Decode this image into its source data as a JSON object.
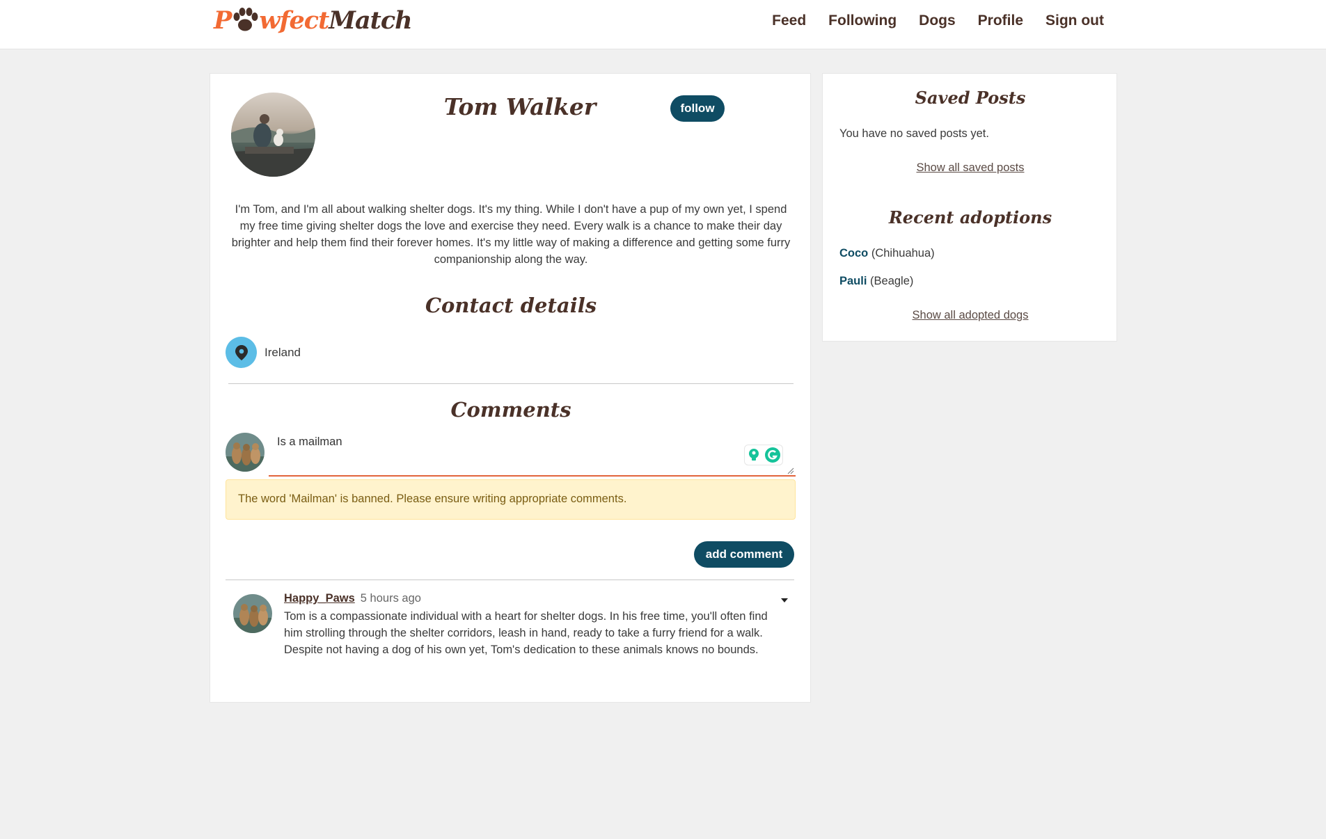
{
  "navbar": {
    "logo": {
      "part1": "P",
      "part2": "wfect",
      "part3": "Match",
      "paw_icon": "paw-icon"
    },
    "links": [
      "Feed",
      "Following",
      "Dogs",
      "Profile",
      "Sign out"
    ]
  },
  "profile": {
    "name": "Tom Walker",
    "follow_label": "follow",
    "bio": "I'm Tom, and I'm all about walking shelter dogs. It's my thing. While I don't have a pup of my own yet, I spend my free time giving shelter dogs the love and exercise they need. Every walk is a chance to make their day brighter and help them find their forever homes. It's my little way of making a difference and getting some furry companionship along the way."
  },
  "contact": {
    "title": "Contact details",
    "location_icon": "map-pin-icon",
    "location": "Ireland"
  },
  "comments": {
    "title": "Comments",
    "input_value": "Is a mailman",
    "alert": "The word 'Mailman' is banned. Please ensure writing appropriate comments.",
    "add_label": "add comment",
    "items": [
      {
        "author": "Happy_Paws",
        "time": "5 hours ago",
        "text": "Tom is a compassionate individual with a heart for shelter dogs. In his free time, you'll often find him strolling through the shelter corridors, leash in hand, ready to take a furry friend for a walk. Despite not having a dog of his own yet, Tom's dedication to these animals knows no bounds."
      }
    ]
  },
  "sidebar": {
    "saved_title": "Saved Posts",
    "no_saved": "You have no saved posts yet.",
    "saved_link": "Show all saved posts",
    "adoptions_title": "Recent adoptions",
    "adoptions": [
      {
        "name": "Coco",
        "breed": "(Chihuahua)"
      },
      {
        "name": "Pauli",
        "breed": "(Beagle)"
      }
    ],
    "adopted_link": "Show all adopted dogs"
  },
  "colors": {
    "brand_orange": "#f26a33",
    "brand_brown": "#4a3128",
    "primary_button": "#0f4c63",
    "pin_circle": "#5cbde6",
    "alert_bg": "#fff3cd"
  }
}
